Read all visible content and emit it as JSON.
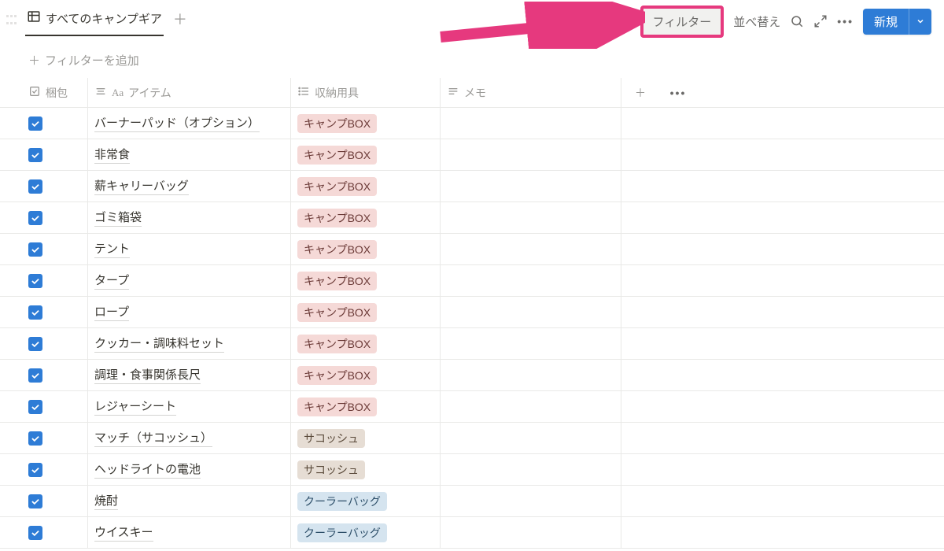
{
  "header": {
    "tab_title": "すべてのキャンプギア",
    "filter_label": "フィルター",
    "sort_label": "並べ替え",
    "new_label": "新規"
  },
  "add_filter": "フィルターを追加",
  "columns": {
    "c0": "梱包",
    "c1": "アイテム",
    "c2": "収納用具",
    "c3": "メモ"
  },
  "rows": [
    {
      "checked": true,
      "item": "バーナーパッド（オプション）",
      "storage": "キャンプBOX",
      "tag_class": "tag-pink"
    },
    {
      "checked": true,
      "item": "非常食",
      "storage": "キャンプBOX",
      "tag_class": "tag-pink"
    },
    {
      "checked": true,
      "item": "薪キャリーバッグ",
      "storage": "キャンプBOX",
      "tag_class": "tag-pink"
    },
    {
      "checked": true,
      "item": "ゴミ箱袋",
      "storage": "キャンプBOX",
      "tag_class": "tag-pink"
    },
    {
      "checked": true,
      "item": "テント",
      "storage": "キャンプBOX",
      "tag_class": "tag-pink"
    },
    {
      "checked": true,
      "item": "タープ",
      "storage": "キャンプBOX",
      "tag_class": "tag-pink"
    },
    {
      "checked": true,
      "item": "ロープ",
      "storage": "キャンプBOX",
      "tag_class": "tag-pink"
    },
    {
      "checked": true,
      "item": "クッカー・調味料セット",
      "storage": "キャンプBOX",
      "tag_class": "tag-pink"
    },
    {
      "checked": true,
      "item": "調理・食事関係長尺",
      "storage": "キャンプBOX",
      "tag_class": "tag-pink"
    },
    {
      "checked": true,
      "item": "レジャーシート",
      "storage": "キャンプBOX",
      "tag_class": "tag-pink"
    },
    {
      "checked": true,
      "item": "マッチ（サコッシュ）",
      "storage": "サコッシュ",
      "tag_class": "tag-brown"
    },
    {
      "checked": true,
      "item": "ヘッドライトの電池",
      "storage": "サコッシュ",
      "tag_class": "tag-brown"
    },
    {
      "checked": true,
      "item": "焼酎",
      "storage": "クーラーバッグ",
      "tag_class": "tag-blue"
    },
    {
      "checked": true,
      "item": "ウイスキー",
      "storage": "クーラーバッグ",
      "tag_class": "tag-blue"
    }
  ]
}
